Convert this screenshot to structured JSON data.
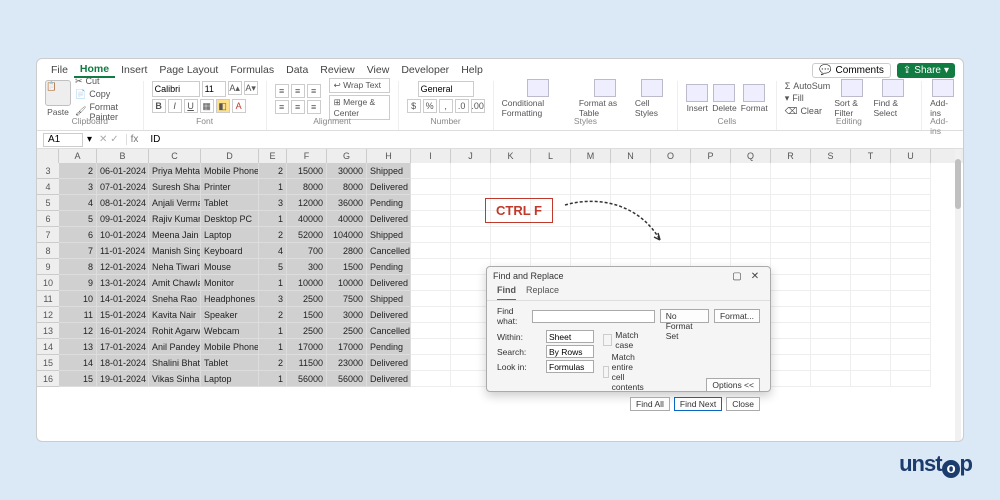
{
  "menu": {
    "file": "File",
    "home": "Home",
    "insert": "Insert",
    "layout": "Page Layout",
    "formulas": "Formulas",
    "data": "Data",
    "review": "Review",
    "view": "View",
    "dev": "Developer",
    "help": "Help",
    "comments": "Comments",
    "share": "Share"
  },
  "ribbon": {
    "clipboard": {
      "label": "Clipboard",
      "paste": "Paste",
      "cut": "Cut",
      "copy": "Copy",
      "fmt": "Format Painter"
    },
    "font": {
      "label": "Font",
      "family": "Calibri",
      "size": "11"
    },
    "align": {
      "label": "Alignment",
      "wrap": "Wrap Text",
      "merge": "Merge & Center"
    },
    "number": {
      "label": "Number",
      "fmt": "General"
    },
    "styles": {
      "label": "Styles",
      "cond": "Conditional Formatting",
      "table": "Format as Table",
      "cell": "Cell Styles"
    },
    "cells": {
      "label": "Cells",
      "ins": "Insert",
      "del": "Delete",
      "fmt": "Format"
    },
    "editing": {
      "label": "Editing",
      "sum": "AutoSum",
      "fill": "Fill",
      "clear": "Clear",
      "sort": "Sort & Filter",
      "find": "Find & Select"
    },
    "addins": {
      "label": "Add-ins",
      "btn": "Add-ins"
    }
  },
  "namebar": {
    "cell": "A1",
    "fx": "fx",
    "value": "ID"
  },
  "cols": [
    "A",
    "B",
    "C",
    "D",
    "E",
    "F",
    "G",
    "H",
    "I",
    "J",
    "K",
    "L",
    "M",
    "N",
    "O",
    "P",
    "Q",
    "R",
    "S",
    "T",
    "U"
  ],
  "rows": [
    3,
    4,
    5,
    6,
    7,
    8,
    9,
    10,
    11,
    12,
    13,
    14,
    15,
    16
  ],
  "data": [
    {
      "id": 2,
      "date": "06-01-2024",
      "name": "Priya Mehta",
      "prod": "Mobile Phone",
      "qty": 2,
      "price": 15000,
      "total": 30000,
      "status": "Shipped"
    },
    {
      "id": 3,
      "date": "07-01-2024",
      "name": "Suresh Sharma",
      "prod": "Printer",
      "qty": 1,
      "price": 8000,
      "total": 8000,
      "status": "Delivered"
    },
    {
      "id": 4,
      "date": "08-01-2024",
      "name": "Anjali Verma",
      "prod": "Tablet",
      "qty": 3,
      "price": 12000,
      "total": 36000,
      "status": "Pending"
    },
    {
      "id": 5,
      "date": "09-01-2024",
      "name": "Rajiv Kumar",
      "prod": "Desktop PC",
      "qty": 1,
      "price": 40000,
      "total": 40000,
      "status": "Delivered"
    },
    {
      "id": 6,
      "date": "10-01-2024",
      "name": "Meena Jain",
      "prod": "Laptop",
      "qty": 2,
      "price": 52000,
      "total": 104000,
      "status": "Shipped"
    },
    {
      "id": 7,
      "date": "11-01-2024",
      "name": "Manish Singh",
      "prod": "Keyboard",
      "qty": 4,
      "price": 700,
      "total": 2800,
      "status": "Cancelled"
    },
    {
      "id": 8,
      "date": "12-01-2024",
      "name": "Neha Tiwari",
      "prod": "Mouse",
      "qty": 5,
      "price": 300,
      "total": 1500,
      "status": "Pending"
    },
    {
      "id": 9,
      "date": "13-01-2024",
      "name": "Amit Chawla",
      "prod": "Monitor",
      "qty": 1,
      "price": 10000,
      "total": 10000,
      "status": "Delivered"
    },
    {
      "id": 10,
      "date": "14-01-2024",
      "name": "Sneha Rao",
      "prod": "Headphones",
      "qty": 3,
      "price": 2500,
      "total": 7500,
      "status": "Shipped"
    },
    {
      "id": 11,
      "date": "15-01-2024",
      "name": "Kavita Nair",
      "prod": "Speaker",
      "qty": 2,
      "price": 1500,
      "total": 3000,
      "status": "Delivered"
    },
    {
      "id": 12,
      "date": "16-01-2024",
      "name": "Rohit Agarwal",
      "prod": "Webcam",
      "qty": 1,
      "price": 2500,
      "total": 2500,
      "status": "Cancelled"
    },
    {
      "id": 13,
      "date": "17-01-2024",
      "name": "Anil Pandey",
      "prod": "Mobile Phone",
      "qty": 1,
      "price": 17000,
      "total": 17000,
      "status": "Pending"
    },
    {
      "id": 14,
      "date": "18-01-2024",
      "name": "Shalini Bhatia",
      "prod": "Tablet",
      "qty": 2,
      "price": 11500,
      "total": 23000,
      "status": "Delivered"
    },
    {
      "id": 15,
      "date": "19-01-2024",
      "name": "Vikas Sinha",
      "prod": "Laptop",
      "qty": 1,
      "price": 56000,
      "total": 56000,
      "status": "Delivered"
    }
  ],
  "ctrlF": "CTRL F",
  "dlg": {
    "title": "Find and Replace",
    "tab_find": "Find",
    "tab_rep": "Replace",
    "find_what": "Find what:",
    "no_fmt": "No Format Set",
    "fmt_btn": "Format...",
    "within_lbl": "Within:",
    "within_val": "Sheet",
    "search_lbl": "Search:",
    "search_val": "By Rows",
    "lookin_lbl": "Look in:",
    "lookin_val": "Formulas",
    "match_case": "Match case",
    "match_cell": "Match entire cell contents",
    "options": "Options <<",
    "find_all": "Find All",
    "find_next": "Find Next",
    "close": "Close"
  },
  "logo": {
    "brand": "unstop"
  }
}
